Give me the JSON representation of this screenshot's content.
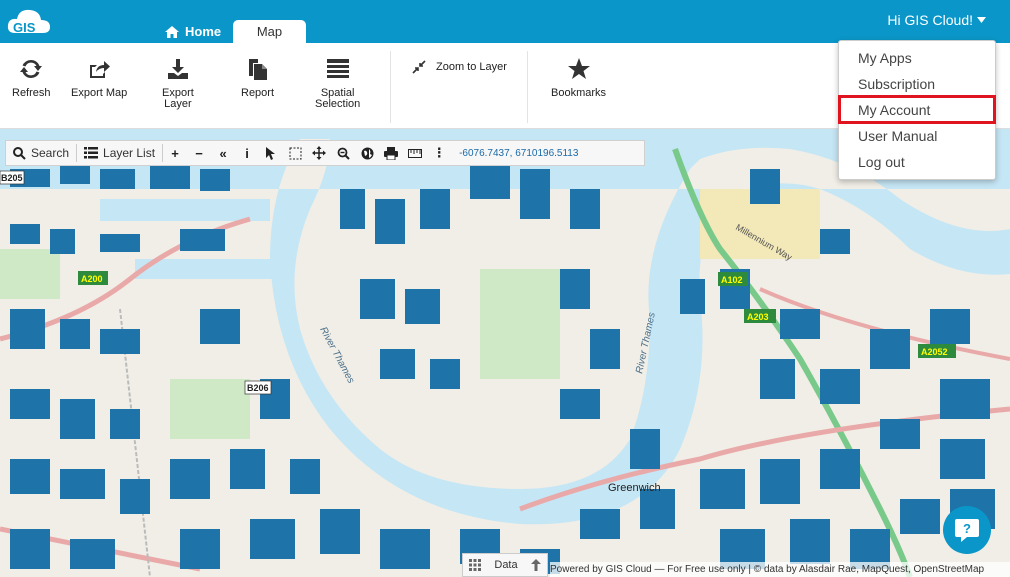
{
  "header": {
    "logo_text": "GIS",
    "tabs": [
      {
        "label": "Home"
      },
      {
        "label": "Map"
      }
    ],
    "greeting": "Hi GIS Cloud!"
  },
  "ribbon": {
    "refresh": "Refresh",
    "export_map": "Export Map",
    "export_layer_1": "Export",
    "export_layer_2": "Layer",
    "report": "Report",
    "spatial_1": "Spatial",
    "spatial_2": "Selection",
    "zoom_to_layer": "Zoom to Layer",
    "bookmarks": "Bookmarks"
  },
  "user_menu": {
    "items": [
      "My Apps",
      "Subscription",
      "My Account",
      "User Manual",
      "Log out"
    ]
  },
  "map_toolbar": {
    "search_label": "Search",
    "layer_list_label": "Layer List",
    "coordinates": "-6076.7437, 6710196.5113"
  },
  "map_labels": {
    "river_1": "River Thames",
    "river_2": "River Thames",
    "road_a102": "A102",
    "road_a203": "A203",
    "road_a2052": "A2052",
    "road_a200": "A200",
    "road_b205": "B205",
    "road_b206": "B206",
    "millennium_way": "Millennium Way",
    "greenwich": "Greenwich"
  },
  "data_tab": {
    "label": "Data"
  },
  "attribution": "Powered by GIS Cloud — For Free use only | © data by Alasdair Rae, MapQuest, OpenStreetMap",
  "colors": {
    "brand": "#0a96c8",
    "highlight": "#e0141e",
    "water": "#c5e6f5",
    "building": "#1e73a8"
  }
}
